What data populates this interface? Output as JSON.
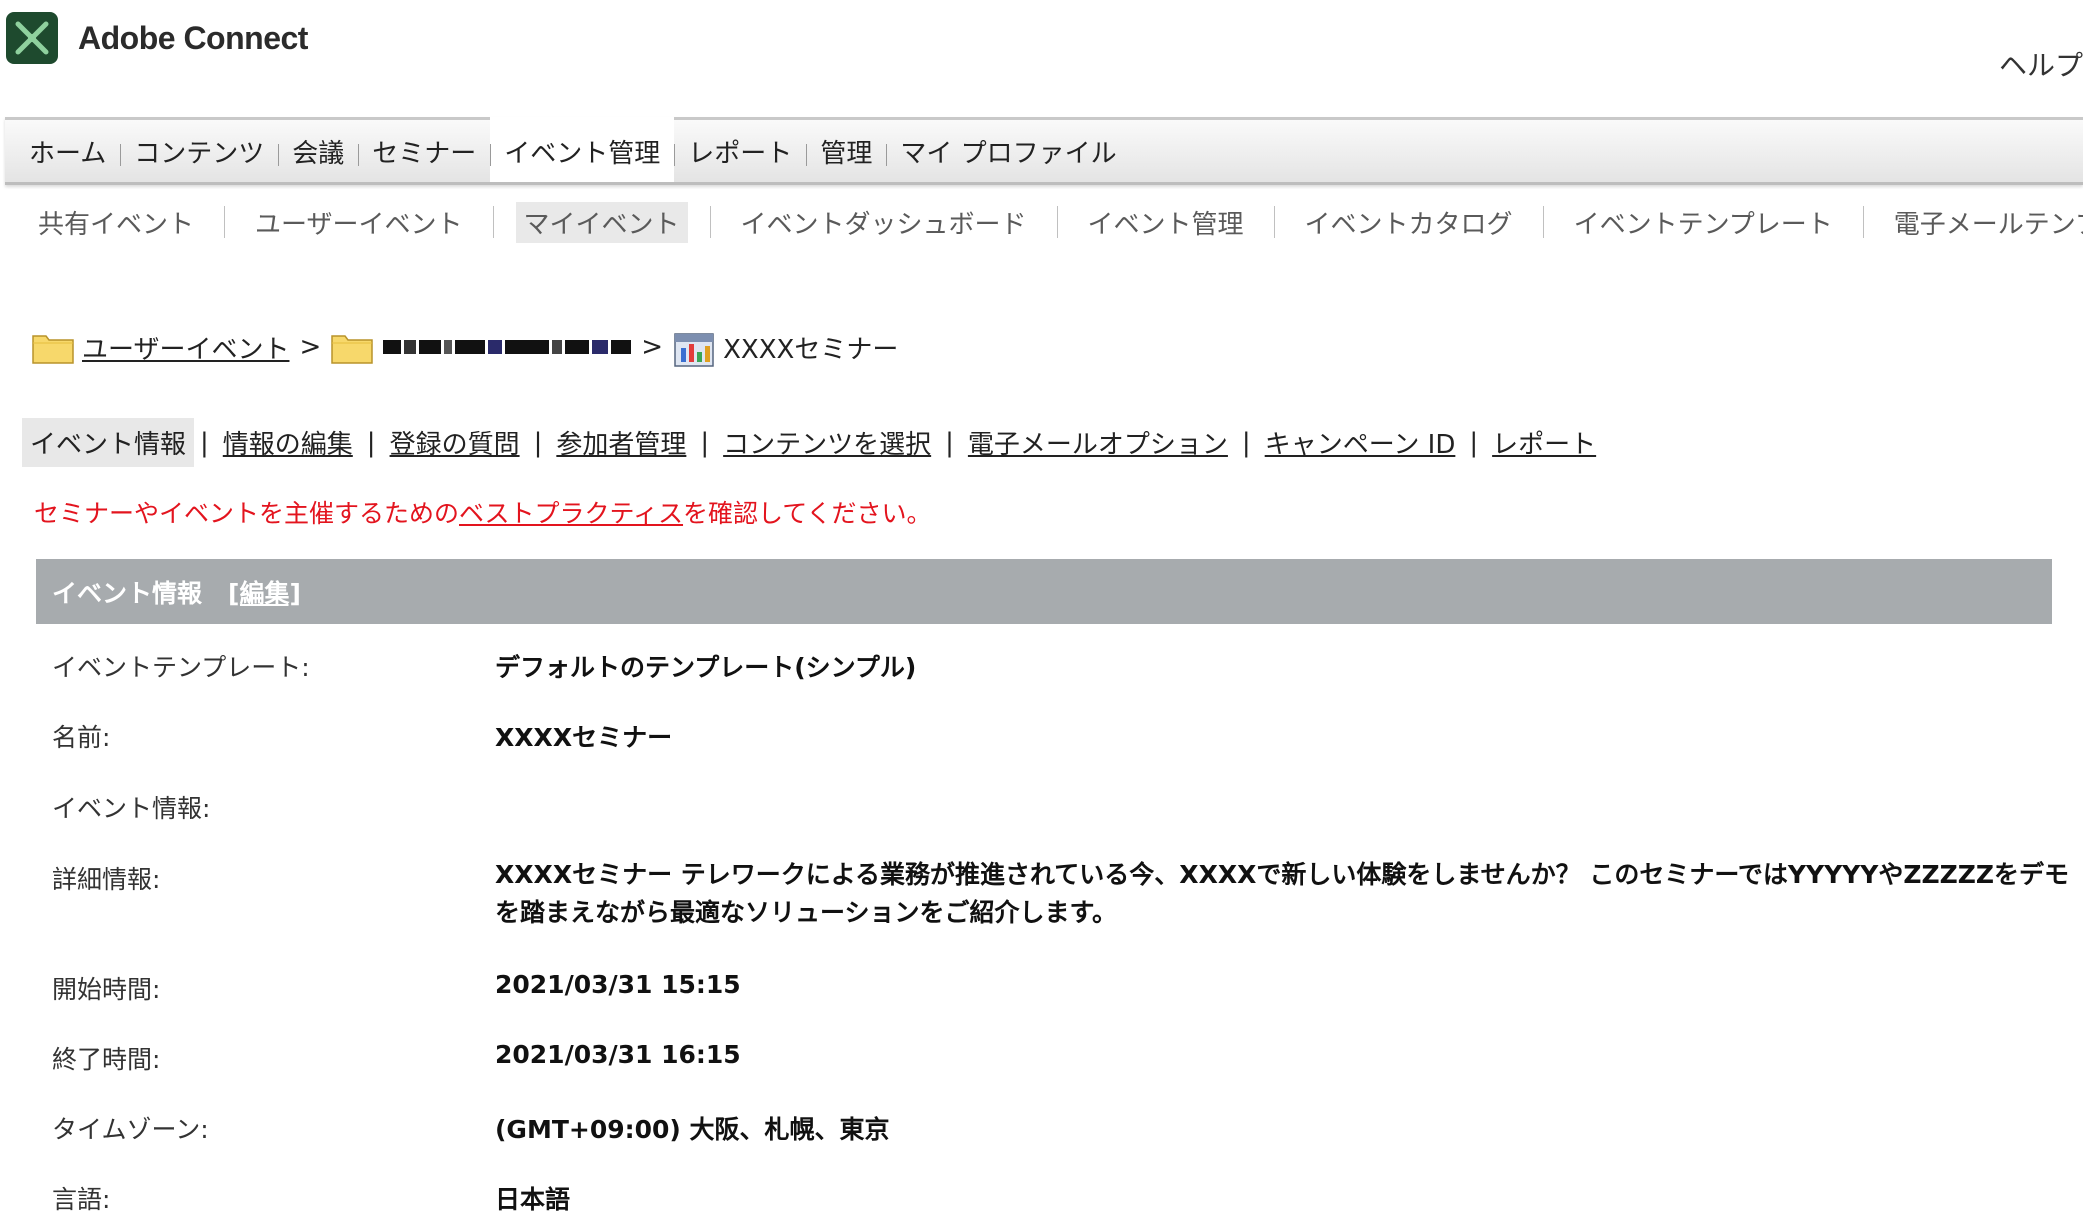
{
  "app": {
    "name": "Adobe Connect",
    "help": "ヘルプ"
  },
  "mainnav": [
    "ホーム",
    "コンテンツ",
    "会議",
    "セミナー",
    "イベント管理",
    "レポート",
    "管理",
    "マイ プロファイル"
  ],
  "mainnav_active": "イベント管理",
  "subnav": [
    "共有イベント",
    "ユーザーイベント",
    "マイイベント",
    "イベントダッシュボード",
    "イベント管理",
    "イベントカタログ",
    "イベントテンプレート",
    "電子メールテンプレー"
  ],
  "subnav_active": "マイイベント",
  "breadcrumb": {
    "root": "ユーザーイベント",
    "sep": ">",
    "current": "XXXXセミナー"
  },
  "tabs": [
    "イベント情報",
    "情報の編集",
    "登録の質問",
    "参加者管理",
    "コンテンツを選択",
    "電子メールオプション",
    "キャンペーン ID",
    "レポート"
  ],
  "tab_sep": "|",
  "notice": {
    "before": "セミナーやイベントを主催するための",
    "link": "ベストプラクティス",
    "after": "を確認してください。"
  },
  "panel": {
    "title": "イベント情報",
    "edit": "[編集]"
  },
  "fields": [
    {
      "label": "イベントテンプレート:",
      "value": "デフォルトのテンプレート(シンプル)"
    },
    {
      "label": "名前:",
      "value": "XXXXセミナー"
    },
    {
      "label": "イベント情報:",
      "value": ""
    },
    {
      "label": "詳細情報:",
      "value": "XXXXセミナー テレワークによる業務が推進されている今、XXXXで新しい体験をしませんか？ このセミナーではYYYYYやZZZZZをデモを踏まえながら最適なソリューションをご紹介します。"
    },
    {
      "label": "開始時間:",
      "value": "2021/03/31 15:15"
    },
    {
      "label": "終了時間:",
      "value": "2021/03/31 16:15"
    },
    {
      "label": "タイムゾーン:",
      "value": "(GMT+09:00) 大阪、札幌、東京"
    },
    {
      "label": "言語:",
      "value": "日本語"
    }
  ],
  "colors": {
    "notice": "#e3141e",
    "panel_header": "#a7abae",
    "logo_bg": "#1e4a2e"
  }
}
